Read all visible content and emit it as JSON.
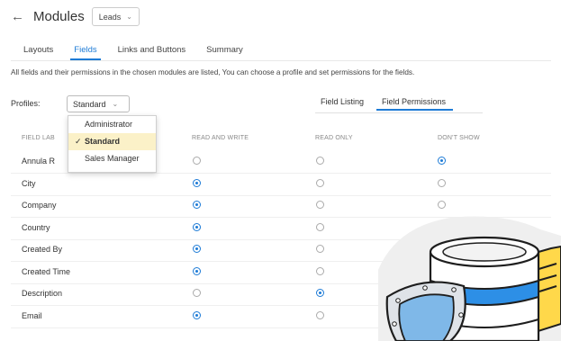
{
  "header": {
    "back_icon": "back-arrow-icon",
    "title": "Modules",
    "module": "Leads"
  },
  "tabs": [
    "Layouts",
    "Fields",
    "Links and Buttons",
    "Summary"
  ],
  "description": "All fields and their permissions in the chosen modules are listed, You can choose a profile and set permissions for the fields.",
  "profile": {
    "label": "Profiles:",
    "selected": "Standard",
    "options": [
      "Administrator",
      "Standard",
      "Sales Manager"
    ]
  },
  "view_toggle": [
    "Field Listing",
    "Field Permissions"
  ],
  "columns": [
    "FIELD LAB",
    "READ AND WRITE",
    "READ ONLY",
    "DON'T SHOW"
  ],
  "rows": [
    {
      "label": "Annula R",
      "perm": "dont_show"
    },
    {
      "label": "City",
      "perm": "read_write"
    },
    {
      "label": "Company",
      "perm": "read_write"
    },
    {
      "label": "Country",
      "perm": "read_write"
    },
    {
      "label": "Created By",
      "perm": "read_write"
    },
    {
      "label": "Created Time",
      "perm": "read_write"
    },
    {
      "label": "Description",
      "perm": "read_only"
    },
    {
      "label": "Email",
      "perm": "read_write"
    }
  ],
  "colors": {
    "accent": "#1d7bd6",
    "selected_bg": "#fbf1c8"
  }
}
